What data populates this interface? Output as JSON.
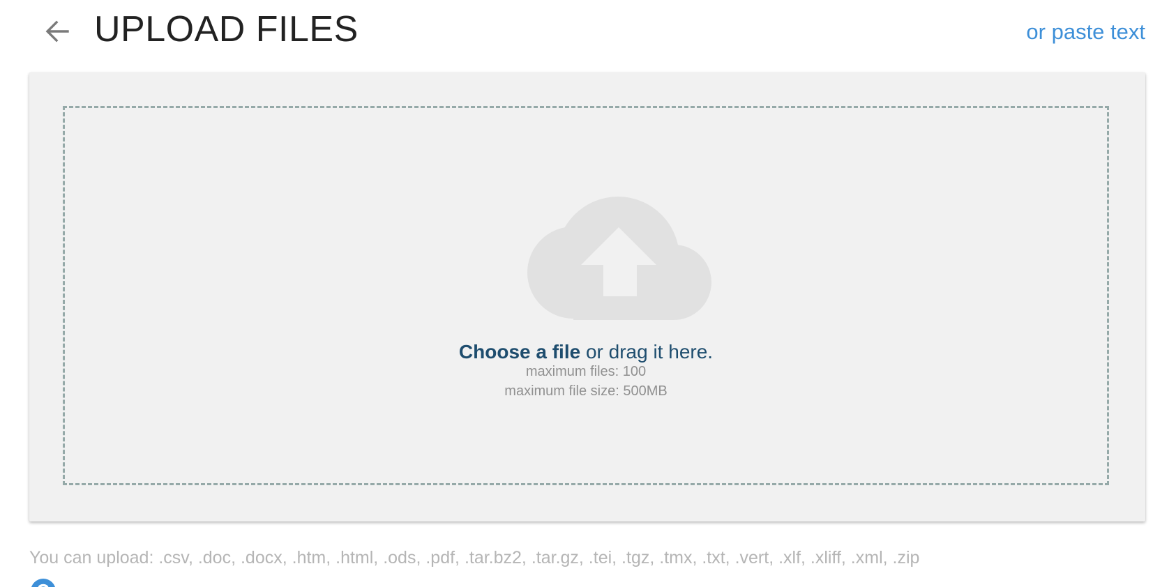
{
  "header": {
    "back_icon": "arrow-left-icon",
    "title": "UPLOAD FILES",
    "paste_link": "or paste text"
  },
  "dropzone": {
    "icon": "cloud-upload-icon",
    "choose_label": "Choose a file",
    "drag_label": " or drag it here.",
    "max_files": "maximum files: 100",
    "max_size": "maximum file size: 500MB"
  },
  "footer": {
    "formats": "You can upload: .csv, .doc, .docx, .htm, .html, .ods, .pdf, .tar.bz2, .tar.gz, .tei, .tgz, .tmx, .txt, .vert, .xlf, .xliff, .xml, .zip",
    "help_icon": "help-circle-icon"
  },
  "colors": {
    "accent": "#3d8fd8",
    "title": "#222222",
    "dropzone_text": "#1e4d6e",
    "dropzone_border": "#95a9a8",
    "card_bg": "#f1f1f1",
    "cloud": "#e1e1e1",
    "muted": "#909090"
  }
}
